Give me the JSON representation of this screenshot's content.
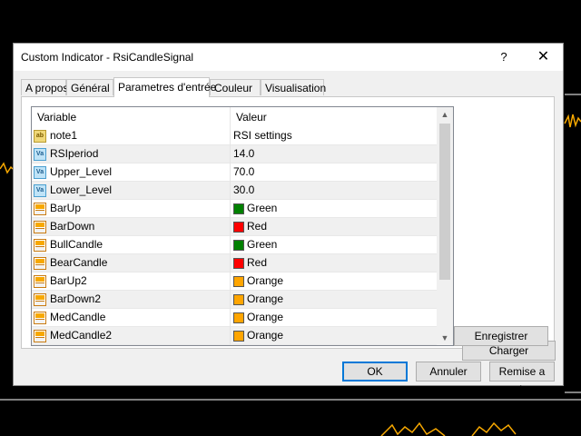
{
  "window": {
    "title": "Custom Indicator - RsiCandleSignal",
    "help_glyph": "?",
    "close_glyph": "✕"
  },
  "tabs": [
    {
      "label": "A propos"
    },
    {
      "label": "Général"
    },
    {
      "label": "Parametres d'entrée"
    },
    {
      "label": "Couleur"
    },
    {
      "label": "Visualisation"
    }
  ],
  "grid": {
    "columns": [
      "Variable",
      "Valeur"
    ],
    "rows": [
      {
        "icon": "text-icon",
        "variable": "note1",
        "value": "RSI settings"
      },
      {
        "icon": "value-icon",
        "variable": "RSIperiod",
        "value": "14.0"
      },
      {
        "icon": "value-icon",
        "variable": "Upper_Level",
        "value": "70.0"
      },
      {
        "icon": "value-icon",
        "variable": "Lower_Level",
        "value": "30.0"
      },
      {
        "icon": "color-icon",
        "variable": "BarUp",
        "value": "Green",
        "color": "#008000"
      },
      {
        "icon": "color-icon",
        "variable": "BarDown",
        "value": "Red",
        "color": "#ff0000"
      },
      {
        "icon": "color-icon",
        "variable": "BullCandle",
        "value": "Green",
        "color": "#008000"
      },
      {
        "icon": "color-icon",
        "variable": "BearCandle",
        "value": "Red",
        "color": "#ff0000"
      },
      {
        "icon": "color-icon",
        "variable": "BarUp2",
        "value": "Orange",
        "color": "#ffa500"
      },
      {
        "icon": "color-icon",
        "variable": "BarDown2",
        "value": "Orange",
        "color": "#ffa500"
      },
      {
        "icon": "color-icon",
        "variable": "MedCandle",
        "value": "Orange",
        "color": "#ffa500"
      },
      {
        "icon": "color-icon",
        "variable": "MedCandle2",
        "value": "Orange",
        "color": "#ffa500"
      }
    ],
    "icon_text": {
      "text": "ab",
      "value": "Va"
    }
  },
  "side_buttons": {
    "load": "Charger",
    "save": "Enregistrer"
  },
  "footer_buttons": {
    "ok": "OK",
    "cancel": "Annuler",
    "reset": "Remise a zéro"
  }
}
